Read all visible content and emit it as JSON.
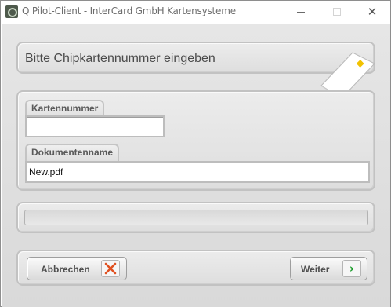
{
  "window": {
    "title": "Q Pilot-Client - InterCard GmbH Kartensysteme",
    "icons": {
      "app": "app-logo-icon",
      "minimize": "minimize-icon",
      "maximize": "maximize-icon",
      "close": "close-icon"
    },
    "close_glyph": "✕"
  },
  "header": {
    "title": "Bitte Chipkartennummer eingeben",
    "icon": "chip-card-icon",
    "colors": {
      "card": "#ffffff",
      "chip": "#f2c200"
    }
  },
  "form": {
    "card_number": {
      "label": "Kartennummer",
      "value": ""
    },
    "document_name": {
      "label": "Dokumentenname",
      "value": "New.pdf"
    }
  },
  "progress": {
    "value": 0
  },
  "actions": {
    "cancel": {
      "label": "Abbrechen",
      "icon": "close-x-icon",
      "icon_color": "#e05020"
    },
    "next": {
      "label": "Weiter",
      "icon": "chevron-right-icon",
      "icon_color": "#1a9c2a",
      "glyph": "›"
    }
  }
}
